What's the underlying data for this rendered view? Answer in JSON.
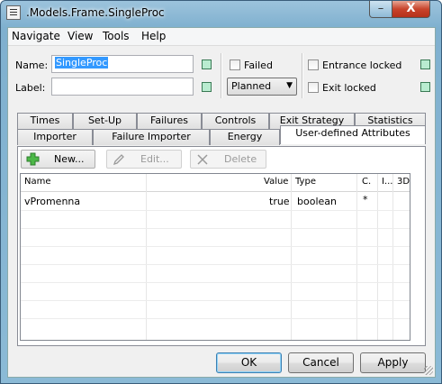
{
  "window": {
    "title": ".Models.Frame.SingleProc",
    "minimize_label": "–",
    "close_label": "X"
  },
  "menu": [
    "Navigate",
    "View",
    "Tools",
    "Help"
  ],
  "form": {
    "name_label": "Name:",
    "name_value": "SingleProc",
    "label_label": "Label:",
    "label_value": "",
    "failed_label": "Failed",
    "planned_value": "Planned",
    "entrance_locked_label": "Entrance locked",
    "exit_locked_label": "Exit locked"
  },
  "tabs_row1": [
    "Times",
    "Set-Up",
    "Failures",
    "Controls",
    "Exit Strategy",
    "Statistics"
  ],
  "tabs_row2": [
    "Importer",
    "Failure Importer",
    "Energy",
    "User-defined Attributes"
  ],
  "active_tab": "User-defined Attributes",
  "toolbar": {
    "new_label": "New...",
    "edit_label": "Edit...",
    "delete_label": "Delete"
  },
  "table": {
    "columns": [
      "Name",
      "Value",
      "Type",
      "C.",
      "I...",
      "3D"
    ],
    "rows": [
      {
        "name": "vPromenna",
        "value": "true",
        "type": "boolean",
        "c": "*",
        "i": "",
        "d3": ""
      }
    ]
  },
  "buttons": {
    "ok_label": "OK",
    "cancel_label": "Cancel",
    "apply_label": "Apply"
  },
  "colors": {
    "title_bar": "#8bbad6",
    "close_button": "#c8442c",
    "selection": "#3399ff",
    "indicator": "#b9ecd0"
  }
}
